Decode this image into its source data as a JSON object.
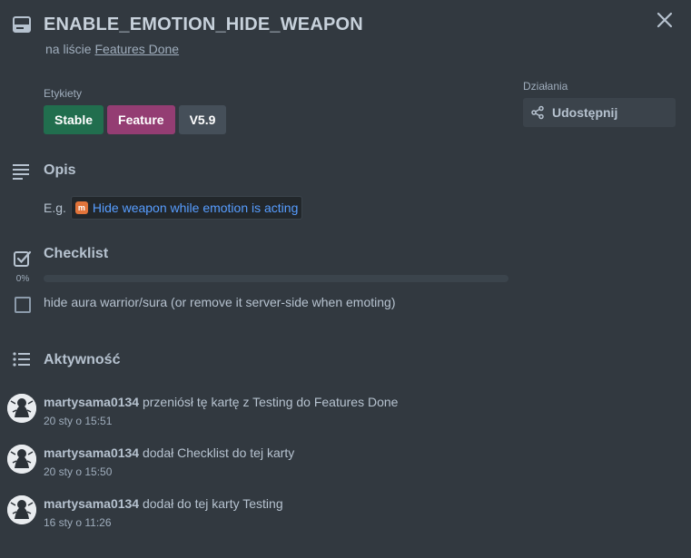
{
  "card": {
    "title": "ENABLE_EMOTION_HIDE_WEAPON",
    "list_prefix": "na liście",
    "list_name": "Features Done"
  },
  "labels": {
    "heading": "Etykiety",
    "items": [
      {
        "text": "Stable",
        "color": "#216e4e"
      },
      {
        "text": "Feature",
        "color": "#943d73"
      },
      {
        "text": "V5.9",
        "color": "#454f59"
      }
    ]
  },
  "actions": {
    "heading": "Działania",
    "share_label": "Udostępnij"
  },
  "description": {
    "title": "Opis",
    "prefix": "E.g.",
    "link_text": "Hide weapon while emotion is acting",
    "link_icon": "github-like-icon"
  },
  "checklist": {
    "title": "Checklist",
    "progress_text": "0%",
    "progress": 0,
    "items": [
      {
        "text": "hide aura warrior/sura (or remove it server-side when emoting)",
        "checked": false
      }
    ]
  },
  "activity": {
    "title": "Aktywność",
    "items": [
      {
        "user": "martysama0134",
        "action": "przeniósł tę kartę z Testing do Features Done",
        "time": "20 sty o 15:51"
      },
      {
        "user": "martysama0134",
        "action": "dodał Checklist do tej karty",
        "time": "20 sty o 15:50"
      },
      {
        "user": "martysama0134",
        "action": "dodał do tej karty Testing",
        "time": "16 sty o 11:26"
      }
    ]
  },
  "colors": {
    "background": "#323940",
    "link": "#579dff"
  }
}
